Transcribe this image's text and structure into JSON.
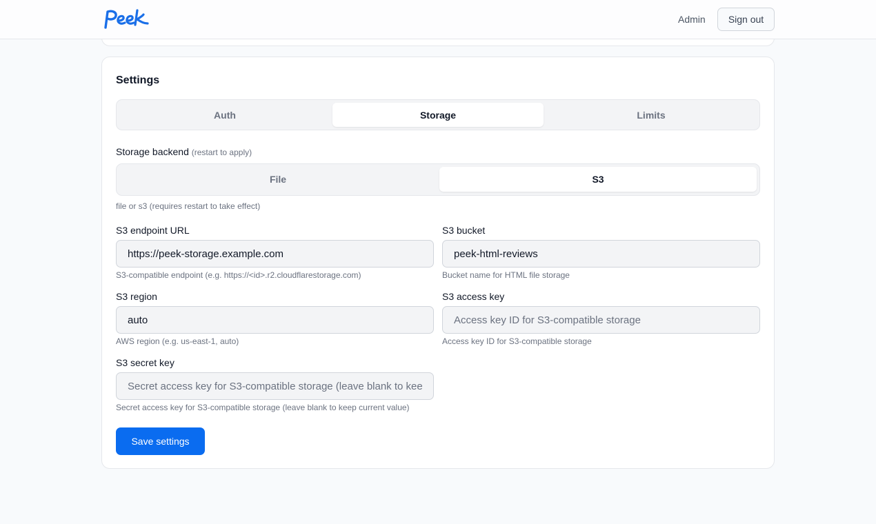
{
  "header": {
    "logo_text": "Peek",
    "admin_label": "Admin",
    "signout_label": "Sign out",
    "brand_color": "#1a6fe8"
  },
  "settings": {
    "title": "Settings",
    "tabs": [
      {
        "label": "Auth",
        "active": false
      },
      {
        "label": "Storage",
        "active": true
      },
      {
        "label": "Limits",
        "active": false
      }
    ],
    "storage_backend": {
      "label": "Storage backend",
      "hint": "(restart to apply)",
      "options": [
        {
          "label": "File",
          "active": false
        },
        {
          "label": "S3",
          "active": true
        }
      ],
      "help": "file or s3 (requires restart to take effect)"
    },
    "fields": {
      "endpoint": {
        "label": "S3 endpoint URL",
        "value": "https://peek-storage.example.com",
        "placeholder": "",
        "help": "S3-compatible endpoint (e.g. https://<id>.r2.cloudflarestorage.com)"
      },
      "bucket": {
        "label": "S3 bucket",
        "value": "peek-html-reviews",
        "placeholder": "",
        "help": "Bucket name for HTML file storage"
      },
      "region": {
        "label": "S3 region",
        "value": "auto",
        "placeholder": "",
        "help": "AWS region (e.g. us-east-1, auto)"
      },
      "access_key": {
        "label": "S3 access key",
        "value": "",
        "placeholder": "Access key ID for S3-compatible storage",
        "help": "Access key ID for S3-compatible storage"
      },
      "secret_key": {
        "label": "S3 secret key",
        "value": "",
        "placeholder": "Secret access key for S3-compatible storage (leave blank to keep current value)",
        "help": "Secret access key for S3-compatible storage (leave blank to keep current value)"
      }
    },
    "save_label": "Save settings",
    "accent_color": "#0a6cf0"
  }
}
